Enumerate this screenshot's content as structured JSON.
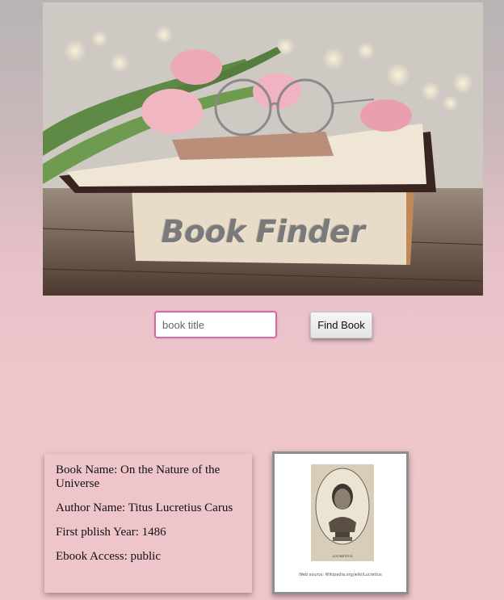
{
  "hero": {
    "title": "Book Finder"
  },
  "search": {
    "placeholder": "book title",
    "button_label": "Find Book"
  },
  "result": {
    "book_name": "Book Name: On the Nature of the Universe",
    "author_name": "Author Name: Titus Lucretius Carus",
    "first_publish_year": "First pblish Year: 1486",
    "ebook_access": "Ebook Access: public",
    "image_label": "LUCRETIUS",
    "image_caption": "Web source: Wikipedia.org/wiki/Lucretius"
  },
  "colors": {
    "page_background": "#efc6cc",
    "input_border": "#d46aa6",
    "card_background": "#eec5cb"
  }
}
